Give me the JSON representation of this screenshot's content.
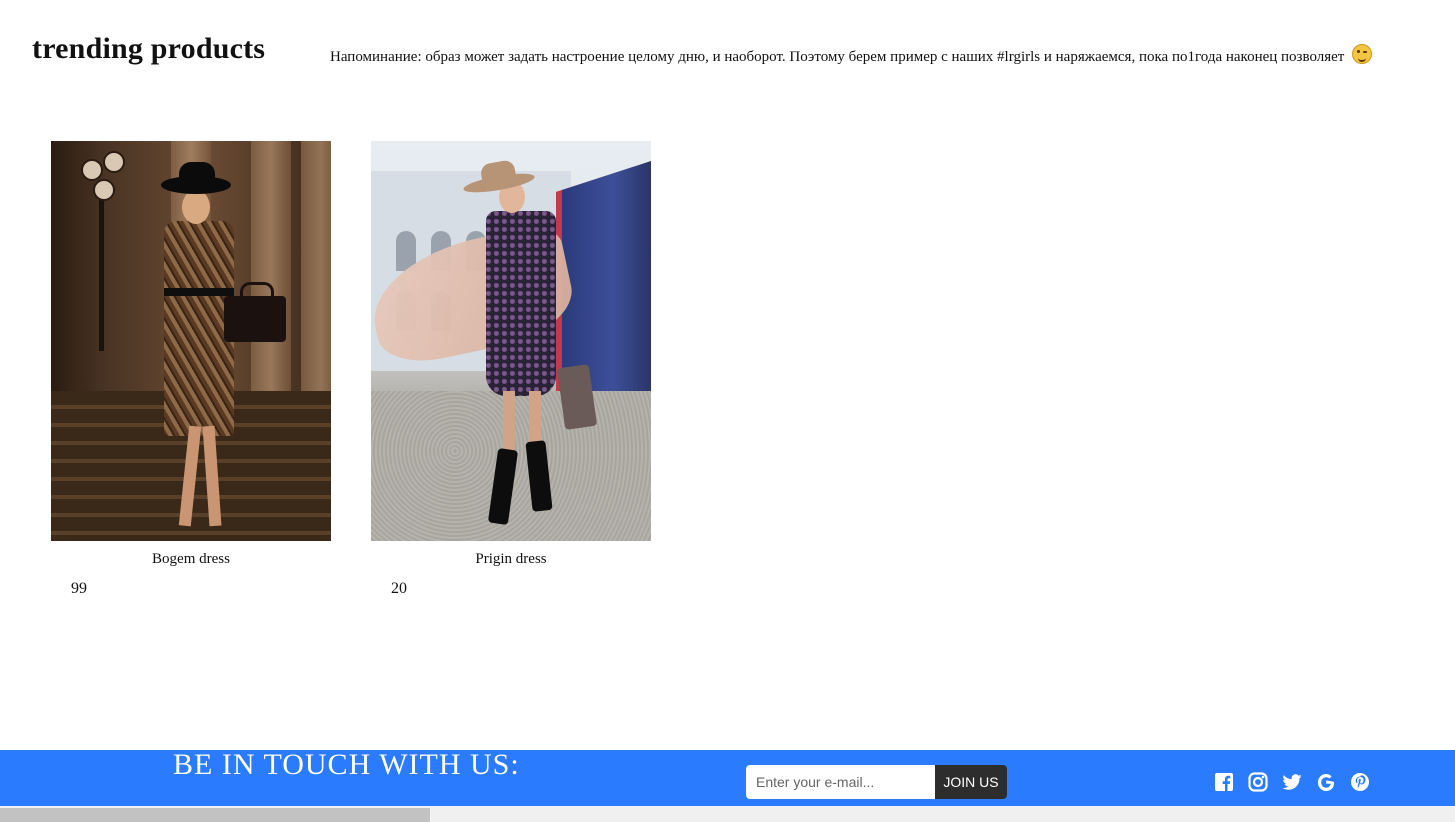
{
  "header": {
    "title": "trending products",
    "reminder": "Напоминание: образ может задать настроение целому дню, и наоборот. Поэтому берем пример с наших #lrgirls и наряжаемся, пока по1года наконец позволяет"
  },
  "products": [
    {
      "name": "Bogem dress",
      "price": "99"
    },
    {
      "name": "Prigin dress",
      "price": "20"
    }
  ],
  "footer": {
    "title": "BE IN TOUCH WITH US:",
    "email_placeholder": "Enter your e-mail...",
    "join_label": "JOIN US",
    "socials": [
      "facebook-icon",
      "instagram-icon",
      "twitter-icon",
      "google-icon",
      "pinterest-icon"
    ]
  },
  "colors": {
    "footer_bg": "#2b7bff",
    "button_bg": "#2d2d2d"
  }
}
